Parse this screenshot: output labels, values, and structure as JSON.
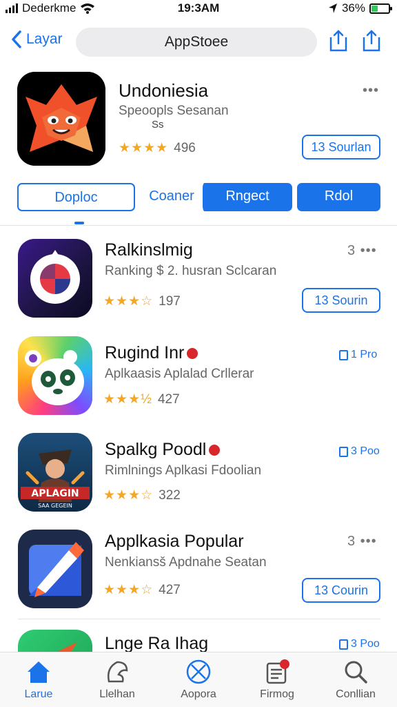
{
  "status_bar": {
    "carrier": "Dederkme",
    "time": "19:3AM",
    "battery": "36%",
    "battery_level": 0.36
  },
  "nav": {
    "back_label": "Layar",
    "search_label": "AppStoee"
  },
  "featured": {
    "title": "Undoniesia",
    "subtitle": "Speoopls Sesanan",
    "subtitle2": "Ss",
    "rating_stars": "★★★★",
    "rating_count": "496",
    "more": "•••",
    "get_label": "13 Sourlan"
  },
  "tabs": [
    {
      "label": "Doploc",
      "style": "outline"
    },
    {
      "label": "Coaner",
      "style": "plain"
    },
    {
      "label": "Rngect",
      "style": "filled"
    },
    {
      "label": "Rdol",
      "style": "filled"
    }
  ],
  "apps": [
    {
      "title": "Ralkinslmig",
      "subtitle": "Ranking $ 2. husran Sclcaran",
      "stars": "★★★☆",
      "count": "197",
      "right_label": "3 •••",
      "button": "13 Sourin"
    },
    {
      "title": "Rugind Inr",
      "subtitle": "Aplkaasis Aplalad Crllerar",
      "stars": "★★★½",
      "count": "427",
      "right_label": "1 Pro",
      "button": ""
    },
    {
      "title": "Spalkg Poodl",
      "subtitle": "Rimlnings Aplkasi Fdoolian",
      "stars": "★★★☆",
      "count": "322",
      "right_label": "3 Poo",
      "button": "",
      "icon_text": "APLAGIN",
      "icon_sub": "SAA GEGEIN"
    },
    {
      "title": "Applkasia Popular",
      "subtitle": "Nenkiansš Apdnahe Seatan",
      "stars": "★★★☆",
      "count": "427",
      "right_label": "3 •••",
      "button": "13 Courin"
    },
    {
      "title": "Lnge Ra Ihag",
      "subtitle": "",
      "stars": "",
      "count": "",
      "right_label": "3 Poo",
      "button": ""
    }
  ],
  "tabbar": [
    {
      "label": "Larue",
      "icon": "home-icon",
      "active": true
    },
    {
      "label": "Llelhan",
      "icon": "games-icon",
      "active": false
    },
    {
      "label": "Aopora",
      "icon": "apps-icon",
      "active": false
    },
    {
      "label": "Firmog",
      "icon": "updates-icon",
      "active": false
    },
    {
      "label": "Conllian",
      "icon": "search-icon",
      "active": false
    }
  ],
  "colors": {
    "accent": "#1a73e8",
    "star": "#f5a623",
    "battery": "#34c759"
  }
}
